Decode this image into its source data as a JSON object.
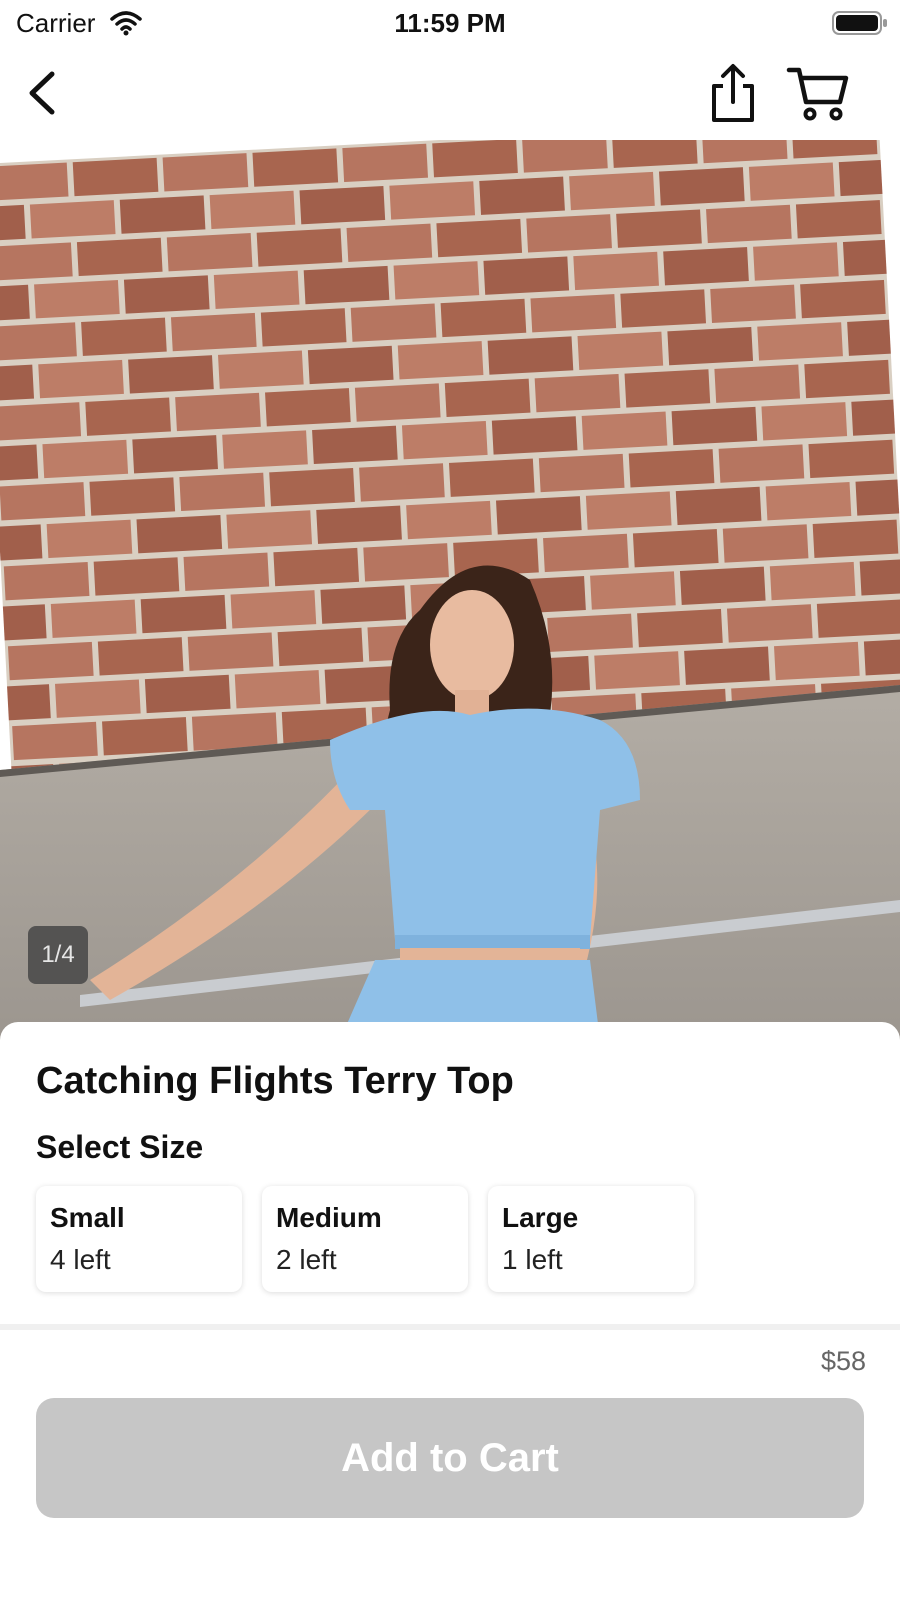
{
  "status_bar": {
    "carrier": "Carrier",
    "time": "11:59 PM"
  },
  "nav": {
    "back_icon": "chevron-left-icon",
    "share_icon": "share-icon",
    "cart_icon": "shopping-cart-icon"
  },
  "gallery": {
    "counter": "1/4"
  },
  "product": {
    "title": "Catching Flights Terry Top",
    "select_size_label": "Select Size",
    "sizes": [
      {
        "name": "Small",
        "stock": "4 left"
      },
      {
        "name": "Medium",
        "stock": "2 left"
      },
      {
        "name": "Large",
        "stock": "1 left"
      }
    ],
    "price": "$58"
  },
  "actions": {
    "add_to_cart_label": "Add to Cart"
  },
  "colors": {
    "button_disabled": "#c6c6c6",
    "brick": "#b5735e",
    "shirt": "#8fc0e8"
  }
}
